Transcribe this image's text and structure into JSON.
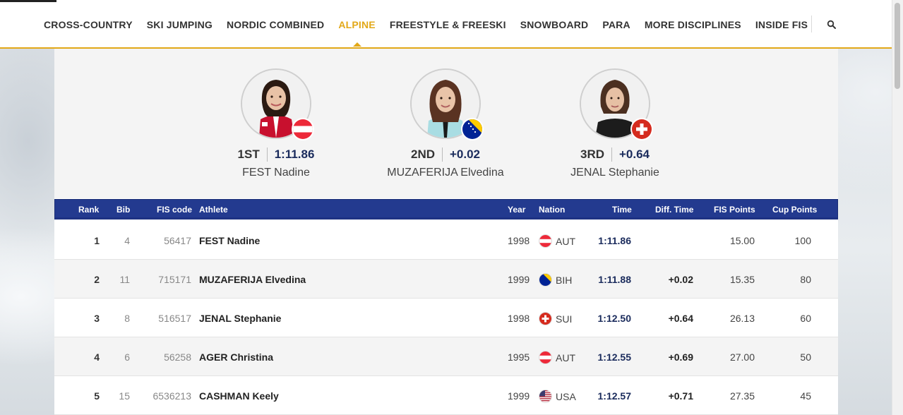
{
  "nav": {
    "items": [
      {
        "label": "CROSS-COUNTRY",
        "active": false
      },
      {
        "label": "SKI JUMPING",
        "active": false
      },
      {
        "label": "NORDIC COMBINED",
        "active": false
      },
      {
        "label": "ALPINE",
        "active": true
      },
      {
        "label": "FREESTYLE & FREESKI",
        "active": false
      },
      {
        "label": "SNOWBOARD",
        "active": false
      },
      {
        "label": "PARA",
        "active": false
      },
      {
        "label": "MORE DISCIPLINES",
        "active": false
      },
      {
        "label": "INSIDE FIS",
        "active": false
      }
    ],
    "search_icon": "search-icon",
    "accent_color": "#e2a818"
  },
  "podium": [
    {
      "place": "1ST",
      "value": "1:11.86",
      "name": "FEST Nadine",
      "nation": "AUT"
    },
    {
      "place": "2ND",
      "value": "+0.02",
      "name": "MUZAFERIJA Elvedina",
      "nation": "BIH"
    },
    {
      "place": "3RD",
      "value": "+0.64",
      "name": "JENAL Stephanie",
      "nation": "SUI"
    }
  ],
  "table": {
    "header_color": "#233a8f",
    "columns": {
      "rank": "Rank",
      "bib": "Bib",
      "fis_code": "FIS code",
      "athlete": "Athlete",
      "year": "Year",
      "nation": "Nation",
      "time": "Time",
      "diff": "Diff. Time",
      "fis_points": "FIS Points",
      "cup_points": "Cup Points"
    },
    "rows": [
      {
        "rank": "1",
        "bib": "4",
        "fis_code": "56417",
        "athlete": "FEST Nadine",
        "year": "1998",
        "nation": "AUT",
        "time": "1:11.86",
        "diff": "",
        "fis_points": "15.00",
        "cup_points": "100"
      },
      {
        "rank": "2",
        "bib": "11",
        "fis_code": "715171",
        "athlete": "MUZAFERIJA Elvedina",
        "year": "1999",
        "nation": "BIH",
        "time": "1:11.88",
        "diff": "+0.02",
        "fis_points": "15.35",
        "cup_points": "80"
      },
      {
        "rank": "3",
        "bib": "8",
        "fis_code": "516517",
        "athlete": "JENAL Stephanie",
        "year": "1998",
        "nation": "SUI",
        "time": "1:12.50",
        "diff": "+0.64",
        "fis_points": "26.13",
        "cup_points": "60"
      },
      {
        "rank": "4",
        "bib": "6",
        "fis_code": "56258",
        "athlete": "AGER Christina",
        "year": "1995",
        "nation": "AUT",
        "time": "1:12.55",
        "diff": "+0.69",
        "fis_points": "27.00",
        "cup_points": "50"
      },
      {
        "rank": "5",
        "bib": "15",
        "fis_code": "6536213",
        "athlete": "CASHMAN Keely",
        "year": "1999",
        "nation": "USA",
        "time": "1:12.57",
        "diff": "+0.71",
        "fis_points": "27.35",
        "cup_points": "45"
      }
    ]
  }
}
